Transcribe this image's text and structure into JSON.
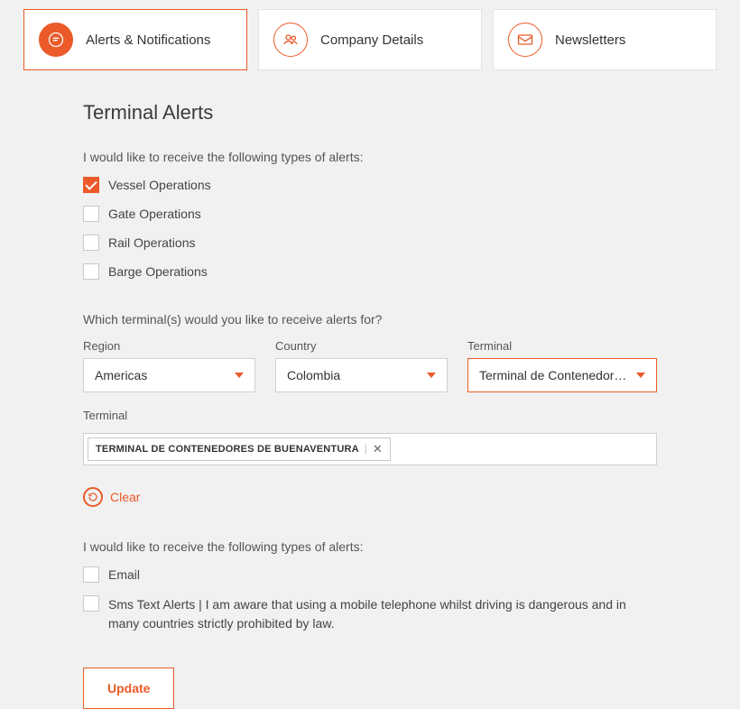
{
  "tabs": [
    {
      "label": "Alerts & Notifications"
    },
    {
      "label": "Company Details"
    },
    {
      "label": "Newsletters"
    }
  ],
  "page_title": "Terminal Alerts",
  "section1_text": "I would like to receive the following types of alerts:",
  "alert_types": [
    {
      "label": "Vessel Operations"
    },
    {
      "label": "Gate Operations"
    },
    {
      "label": "Rail Operations"
    },
    {
      "label": "Barge Operations"
    }
  ],
  "section2_text": "Which terminal(s) would you like to receive alerts for?",
  "selects": {
    "region": {
      "label": "Region",
      "value": "Americas"
    },
    "country": {
      "label": "Country",
      "value": "Colombia"
    },
    "terminal": {
      "label": "Terminal",
      "value": "Terminal de Contenedores de..."
    }
  },
  "terminal_chip": {
    "label": "Terminal",
    "value": "TERMINAL DE CONTENEDORES DE BUENAVENTURA"
  },
  "clear_label": "Clear",
  "section3_text": "I would like to receive the following types of alerts:",
  "delivery": [
    {
      "label": "Email"
    },
    {
      "label": "Sms Text Alerts | I am aware that using a mobile telephone whilst driving is dangerous and in many countries strictly prohibited by law."
    }
  ],
  "update_label": "Update"
}
